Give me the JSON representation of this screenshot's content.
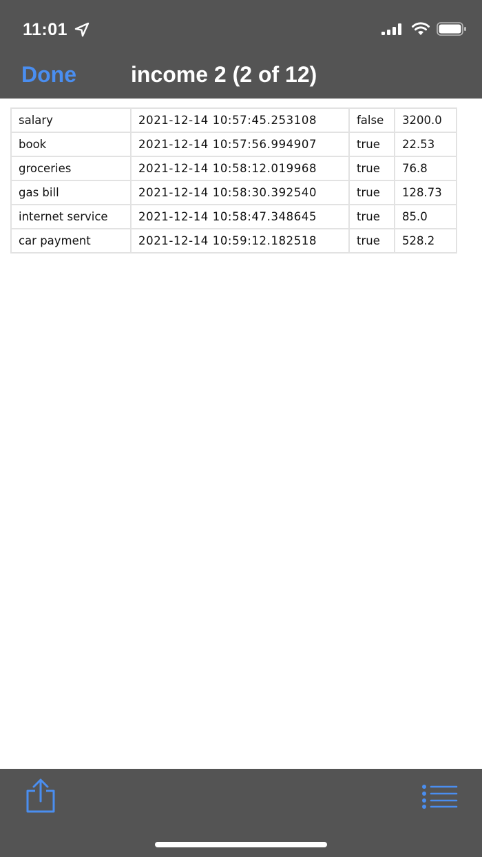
{
  "status_bar": {
    "time": "11:01",
    "icons": [
      "location-arrow-icon",
      "cellular-signal-icon",
      "wifi-icon",
      "battery-icon"
    ]
  },
  "nav": {
    "done_label": "Done",
    "title": "income 2 (2 of 12)"
  },
  "table": {
    "rows": [
      {
        "name": "salary",
        "timestamp": "2021-12-14 10:57:45.253108",
        "flag": "false",
        "amount": "3200.0"
      },
      {
        "name": "book",
        "timestamp": "2021-12-14 10:57:56.994907",
        "flag": "true",
        "amount": "22.53"
      },
      {
        "name": "groceries",
        "timestamp": "2021-12-14 10:58:12.019968",
        "flag": "true",
        "amount": "76.8"
      },
      {
        "name": "gas bill",
        "timestamp": "2021-12-14 10:58:30.392540",
        "flag": "true",
        "amount": "128.73"
      },
      {
        "name": "internet service",
        "timestamp": "2021-12-14 10:58:47.348645",
        "flag": "true",
        "amount": "85.0"
      },
      {
        "name": "car payment",
        "timestamp": "2021-12-14 10:59:12.182518",
        "flag": "true",
        "amount": "528.2"
      }
    ]
  },
  "toolbar": {
    "icons": [
      "share-icon",
      "list-icon"
    ]
  },
  "colors": {
    "bar_background": "#545454",
    "accent": "#4a8ef0",
    "grid_line": "#e2e2e2"
  }
}
